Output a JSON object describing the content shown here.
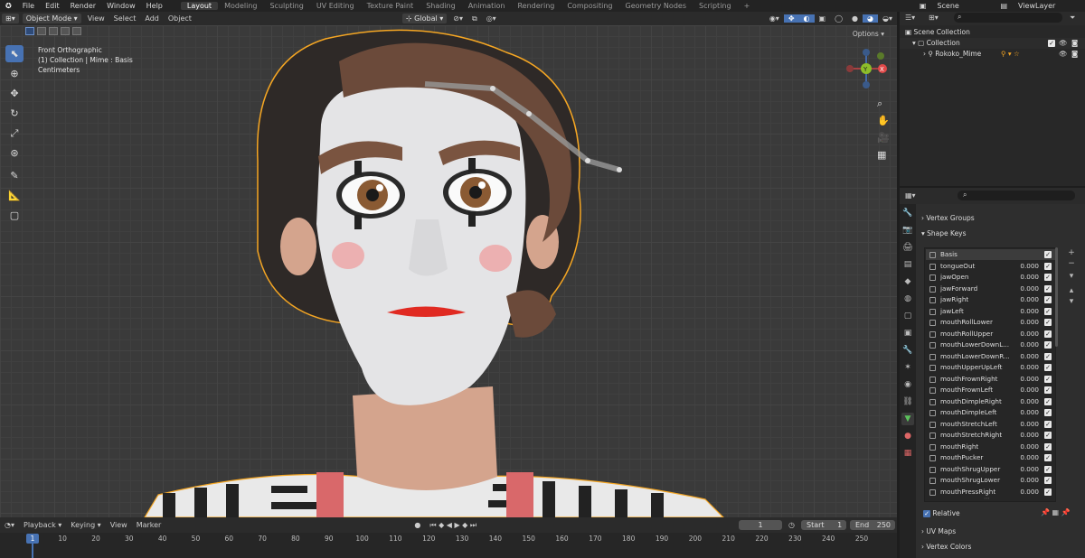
{
  "topbar": {
    "logo": "blender-logo",
    "menus": [
      "File",
      "Edit",
      "Render",
      "Window",
      "Help"
    ],
    "workspaces": [
      "Layout",
      "Modeling",
      "Sculpting",
      "UV Editing",
      "Texture Paint",
      "Shading",
      "Animation",
      "Rendering",
      "Compositing",
      "Geometry Nodes",
      "Scripting"
    ],
    "active_workspace": "Layout",
    "add_tab": "+",
    "scene": "Scene",
    "view_layer": "ViewLayer"
  },
  "viewport_header": {
    "mode": "Object Mode",
    "menus": [
      "View",
      "Select",
      "Add",
      "Object"
    ],
    "transform_orientation": "Global",
    "options": "Options"
  },
  "viewport": {
    "view_name": "Front Orthographic",
    "object_info": "(1) Collection | Mime : Basis",
    "units": "Centimeters",
    "gizmo": {
      "x": "X",
      "y": "Y",
      "z": "Z"
    }
  },
  "timeline": {
    "menus": [
      "Playback",
      "Keying",
      "View",
      "Marker"
    ],
    "current_frame": "1",
    "start_label": "Start",
    "start": "1",
    "end_label": "End",
    "end": "250",
    "ruler_current": "1",
    "ticks": [
      "10",
      "20",
      "30",
      "40",
      "50",
      "60",
      "70",
      "80",
      "90",
      "100",
      "110",
      "120",
      "130",
      "140",
      "150",
      "160",
      "170",
      "180",
      "190",
      "200",
      "210",
      "220",
      "230",
      "240",
      "250"
    ]
  },
  "outliner": {
    "scene_collection": "Scene Collection",
    "collection": "Collection",
    "object": "Rokoko_Mime"
  },
  "properties": {
    "vertex_groups": "Vertex Groups",
    "shape_keys": "Shape Keys",
    "relative": "Relative",
    "uv_maps": "UV Maps",
    "vertex_colors": "Vertex Colors",
    "basis": "Basis",
    "keys": [
      {
        "name": "tongueOut",
        "value": "0.000"
      },
      {
        "name": "jawOpen",
        "value": "0.000"
      },
      {
        "name": "jawForward",
        "value": "0.000"
      },
      {
        "name": "jawRight",
        "value": "0.000"
      },
      {
        "name": "jawLeft",
        "value": "0.000"
      },
      {
        "name": "mouthRollLower",
        "value": "0.000"
      },
      {
        "name": "mouthRollUpper",
        "value": "0.000"
      },
      {
        "name": "mouthLowerDownL...",
        "value": "0.000"
      },
      {
        "name": "mouthLowerDownR...",
        "value": "0.000"
      },
      {
        "name": "mouthUpperUpLeft",
        "value": "0.000"
      },
      {
        "name": "mouthFrownRight",
        "value": "0.000"
      },
      {
        "name": "mouthFrownLeft",
        "value": "0.000"
      },
      {
        "name": "mouthDimpleRight",
        "value": "0.000"
      },
      {
        "name": "mouthDimpleLeft",
        "value": "0.000"
      },
      {
        "name": "mouthStretchLeft",
        "value": "0.000"
      },
      {
        "name": "mouthStretchRight",
        "value": "0.000"
      },
      {
        "name": "mouthRight",
        "value": "0.000"
      },
      {
        "name": "mouthPucker",
        "value": "0.000"
      },
      {
        "name": "mouthShrugUpper",
        "value": "0.000"
      },
      {
        "name": "mouthShrugLower",
        "value": "0.000"
      },
      {
        "name": "mouthPressRight",
        "value": "0.000"
      }
    ]
  },
  "colors": {
    "accent": "#4772b3",
    "selection_outline": "#f5a623"
  }
}
